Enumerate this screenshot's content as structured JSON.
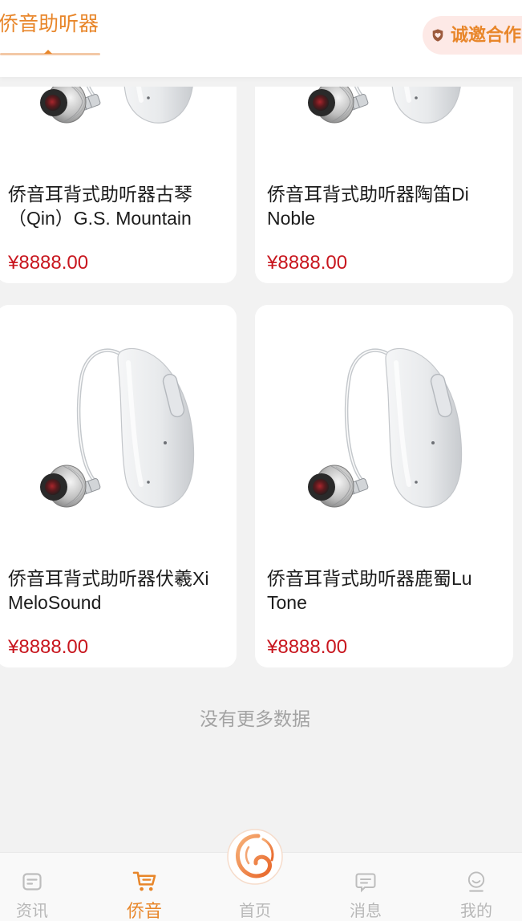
{
  "header": {
    "title": "侨音助听器",
    "cooperate_label": "诚邀合作",
    "cooperate_icon": "shield-heart-icon"
  },
  "colors": {
    "accent": "#e8862a",
    "price": "#c8161e",
    "inactive": "#b8b8b8",
    "badge_bg": "#fde9e6"
  },
  "products": [
    {
      "name": "侨音耳背式助听器古琴（Qin）G.S. Mountain",
      "price": "¥8888.00",
      "image": "hearing-aid-image"
    },
    {
      "name": "侨音耳背式助听器陶笛Di Noble",
      "price": "¥8888.00",
      "image": "hearing-aid-image"
    },
    {
      "name": "侨音耳背式助听器伏羲Xi MeloSound",
      "price": "¥8888.00",
      "image": "hearing-aid-image"
    },
    {
      "name": "侨音耳背式助听器鹿蜀Lu Tone",
      "price": "¥8888.00",
      "image": "hearing-aid-image"
    }
  ],
  "list_end_text": "没有更多数据",
  "tabbar": {
    "items": [
      {
        "label": "资讯",
        "icon": "news-icon",
        "active": false
      },
      {
        "label": "侨音",
        "icon": "cart-icon",
        "active": true
      },
      {
        "label": "首页",
        "icon": "home-logo-icon",
        "active": false
      },
      {
        "label": "消息",
        "icon": "message-icon",
        "active": false
      },
      {
        "label": "我的",
        "icon": "profile-icon",
        "active": false
      }
    ]
  }
}
